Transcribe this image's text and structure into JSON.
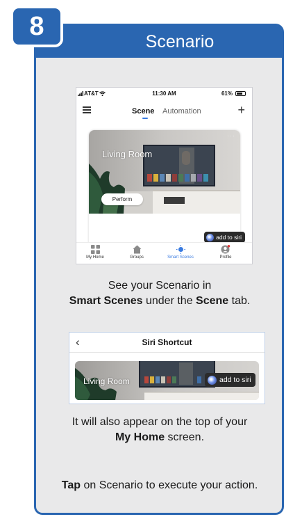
{
  "step": {
    "number": "8",
    "title": "Scenario"
  },
  "colors": {
    "brand_blue": "#2a66b1",
    "panel_bg": "#e9e9ea",
    "tab_accent": "#3a7be0"
  },
  "phone_status": {
    "carrier": "AT&T",
    "time": "11:30 AM",
    "battery": "61%"
  },
  "app_header": {
    "menu_icon": "hamburger-menu-icon",
    "tab_scene": "Scene",
    "tab_automation": "Automation",
    "add_icon": "+"
  },
  "scene_card": {
    "room_name": "Living Room",
    "perform_label": "Perform",
    "more_icon": "···",
    "siri_label": "add to siri"
  },
  "bottom_nav": [
    {
      "label": "My Home",
      "icon": "grid-icon"
    },
    {
      "label": "Groups",
      "icon": "house-icon"
    },
    {
      "label": "Smart Scenes",
      "icon": "sun-icon"
    },
    {
      "label": "Profile",
      "icon": "profile-icon"
    }
  ],
  "caption1": {
    "line1": "See your Scenario in",
    "smart_scenes": "Smart Scenes",
    "under_the": " under the ",
    "scene": "Scene",
    "tab": " tab."
  },
  "siri_shortcut_screen": {
    "title": "Siri Shortcut",
    "room_name": "Living Room",
    "siri_label": "add to siri"
  },
  "caption2": {
    "line1": "It will also appear on the top of your",
    "my_home": "My Home",
    "screen": " screen."
  },
  "caption3": {
    "tap": "Tap",
    "rest": " on Scenario to execute your action."
  }
}
